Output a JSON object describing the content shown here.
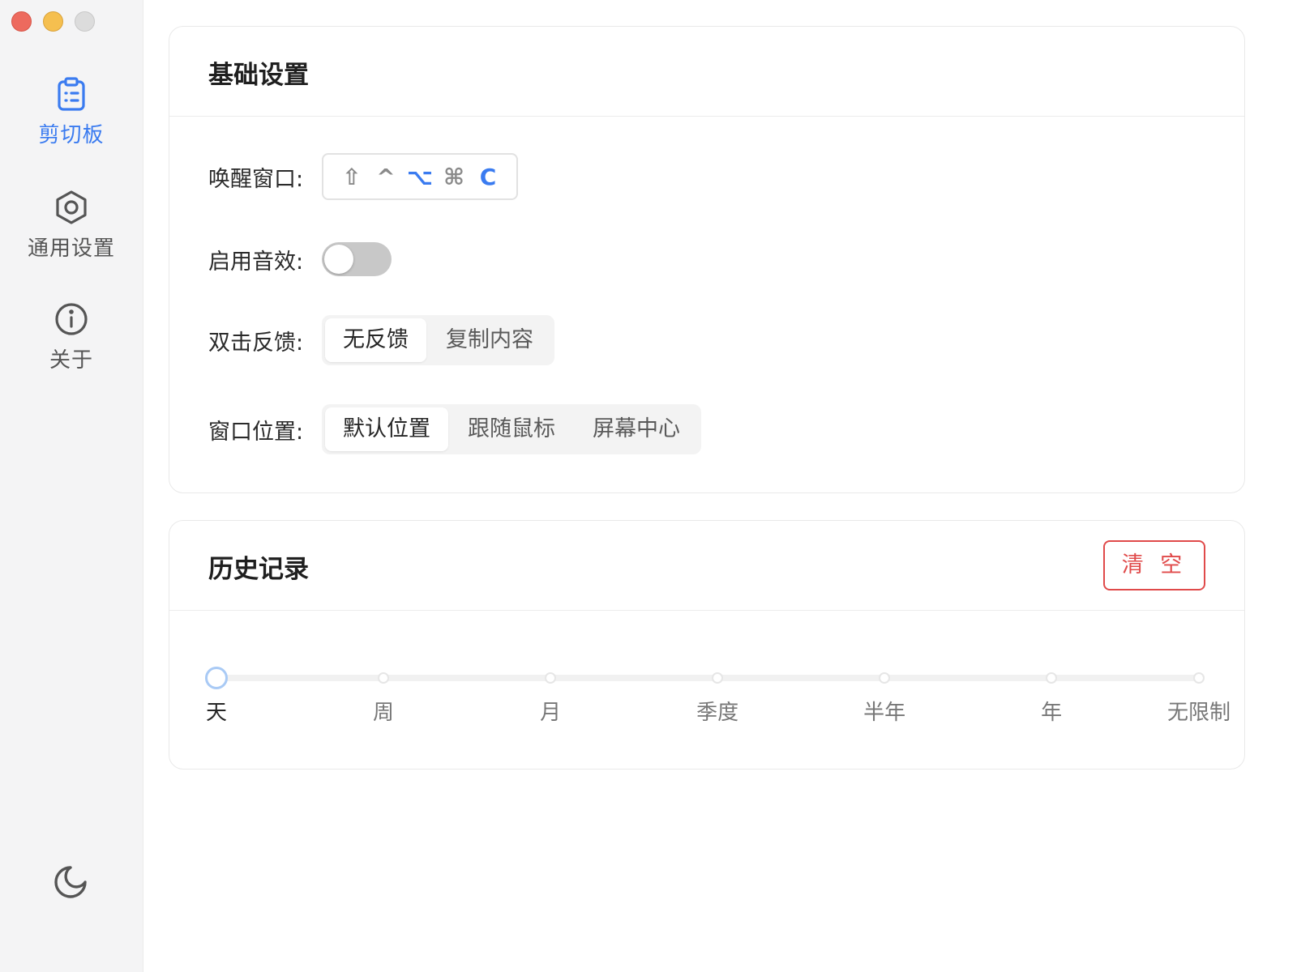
{
  "sidebar": {
    "items": [
      {
        "label": "剪切板",
        "icon": "clipboard-icon",
        "active": true
      },
      {
        "label": "通用设置",
        "icon": "hexagon-settings-icon",
        "active": false
      },
      {
        "label": "关于",
        "icon": "info-icon",
        "active": false
      }
    ],
    "theme_icon": "moon-icon"
  },
  "basic": {
    "title": "基础设置",
    "wake_label": "唤醒窗口:",
    "shortcut_keys": [
      "⇧",
      "^",
      "⌥",
      "⌘",
      "C"
    ],
    "sound_label": "启用音效:",
    "sound_enabled": false,
    "dblclick_label": "双击反馈:",
    "dblclick_options": [
      "无反馈",
      "复制内容"
    ],
    "dblclick_selected": "无反馈",
    "position_label": "窗口位置:",
    "position_options": [
      "默认位置",
      "跟随鼠标",
      "屏幕中心"
    ],
    "position_selected": "默认位置"
  },
  "history": {
    "title": "历史记录",
    "clear_label": "清 空",
    "marks": [
      "天",
      "周",
      "月",
      "季度",
      "半年",
      "年",
      "无限制"
    ],
    "selected": "天"
  },
  "colors": {
    "accent": "#3a7bf0",
    "danger": "#e04a4a"
  }
}
